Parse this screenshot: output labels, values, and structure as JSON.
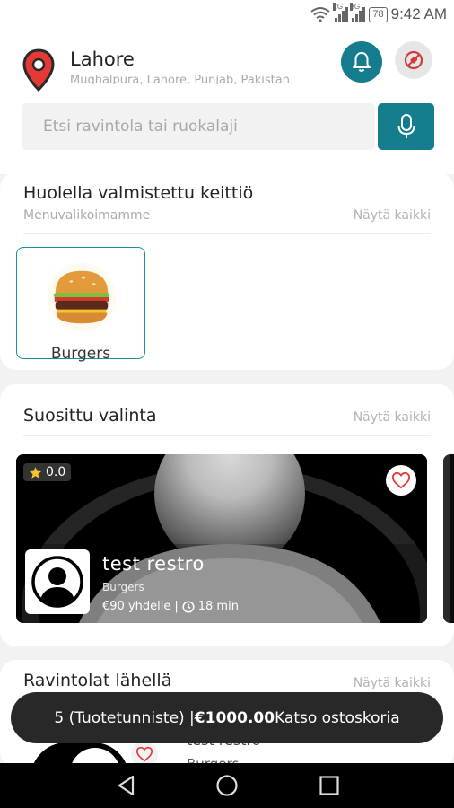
{
  "status_bar": {
    "time": "9:42 AM",
    "battery": "78",
    "network_1": "2G",
    "network_2": "3G",
    "wifi_icon": "wifi-icon"
  },
  "location": {
    "city": "Lahore",
    "address": "Mughalpura, Lahore, Punjab, Pakistan",
    "icon": "location-pin-icon"
  },
  "search": {
    "placeholder": "Etsi ravintola tai ruokalaji"
  },
  "colors": {
    "accent": "#147c8c",
    "cart_bar": "#282828",
    "pin": "#e53935"
  },
  "cuisine_section": {
    "title": "Huolella valmistettu keittiö",
    "subtitle": "Menuvalikoimamme",
    "see_all": "Näytä kaikki",
    "categories": [
      {
        "label": "Burgers"
      }
    ]
  },
  "popular_section": {
    "title": "Suosittu valinta",
    "see_all": "Näytä kaikki",
    "restaurants": [
      {
        "rating": "0.0",
        "name": "test restro",
        "cuisine": "Burgers",
        "price": "€90 yhdelle",
        "delivery_time": "18 min"
      }
    ]
  },
  "nearby_section": {
    "title": "Ravintolat lähellä",
    "see_all": "Näytä kaikki",
    "restaurants": [
      {
        "name": "test restro",
        "cuisine": "Burgers"
      }
    ]
  },
  "cart": {
    "items": "5 (Tuotetunniste) |",
    "total": "€1000.00",
    "action": "Katso ostoskoria"
  },
  "nav": {
    "back": "back-icon",
    "home": "home-icon",
    "recents": "recents-icon"
  }
}
